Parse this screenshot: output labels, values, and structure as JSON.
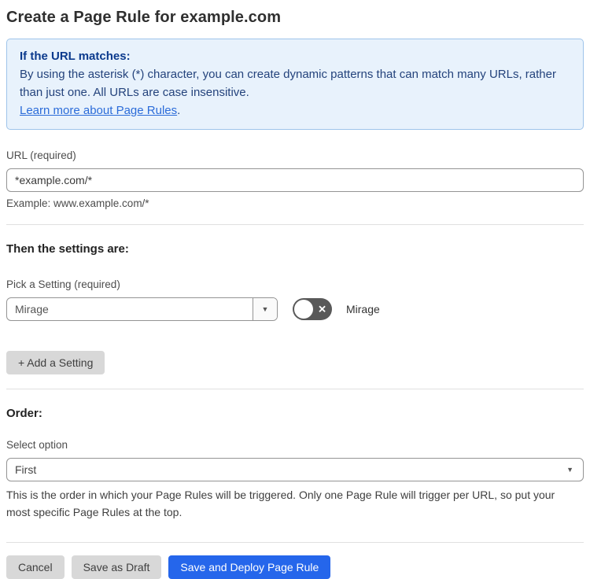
{
  "page": {
    "title": "Create a Page Rule for example.com"
  },
  "info_box": {
    "heading": "If the URL matches:",
    "body": "By using the asterisk (*) character, you can create dynamic patterns that can match many URLs, rather than just one. All URLs are case insensitive.",
    "link_text": "Learn more about Page Rules",
    "link_suffix": "."
  },
  "url_field": {
    "label": "URL (required)",
    "value": "*example.com/*",
    "example": "Example: www.example.com/*"
  },
  "settings_section": {
    "heading": "Then the settings are:",
    "picker_label": "Pick a Setting (required)",
    "selected_setting": "Mirage",
    "toggle": {
      "state": "off",
      "label": "Mirage"
    },
    "add_button_label": "+ Add a Setting"
  },
  "order_section": {
    "heading": "Order:",
    "label": "Select option",
    "selected_option": "First",
    "help_text": "This is the order in which your Page Rules will be triggered. Only one Page Rule will trigger per URL, so put your most specific Page Rules at the top."
  },
  "actions": {
    "cancel_label": "Cancel",
    "save_draft_label": "Save as Draft",
    "save_deploy_label": "Save and Deploy Page Rule"
  },
  "icons": {
    "dropdown_arrow": "▼",
    "toggle_off_x": "✕"
  },
  "colors": {
    "info_bg": "#e8f2fc",
    "info_border": "#9fc4ea",
    "info_heading_text": "#0b3a8d",
    "info_body_text": "#24437c",
    "link": "#2b6cd9",
    "primary_button": "#2566eb",
    "gray_button": "#d8d8d8",
    "toggle_off": "#595959",
    "input_border": "#949494",
    "divider": "#e0e0e0"
  }
}
